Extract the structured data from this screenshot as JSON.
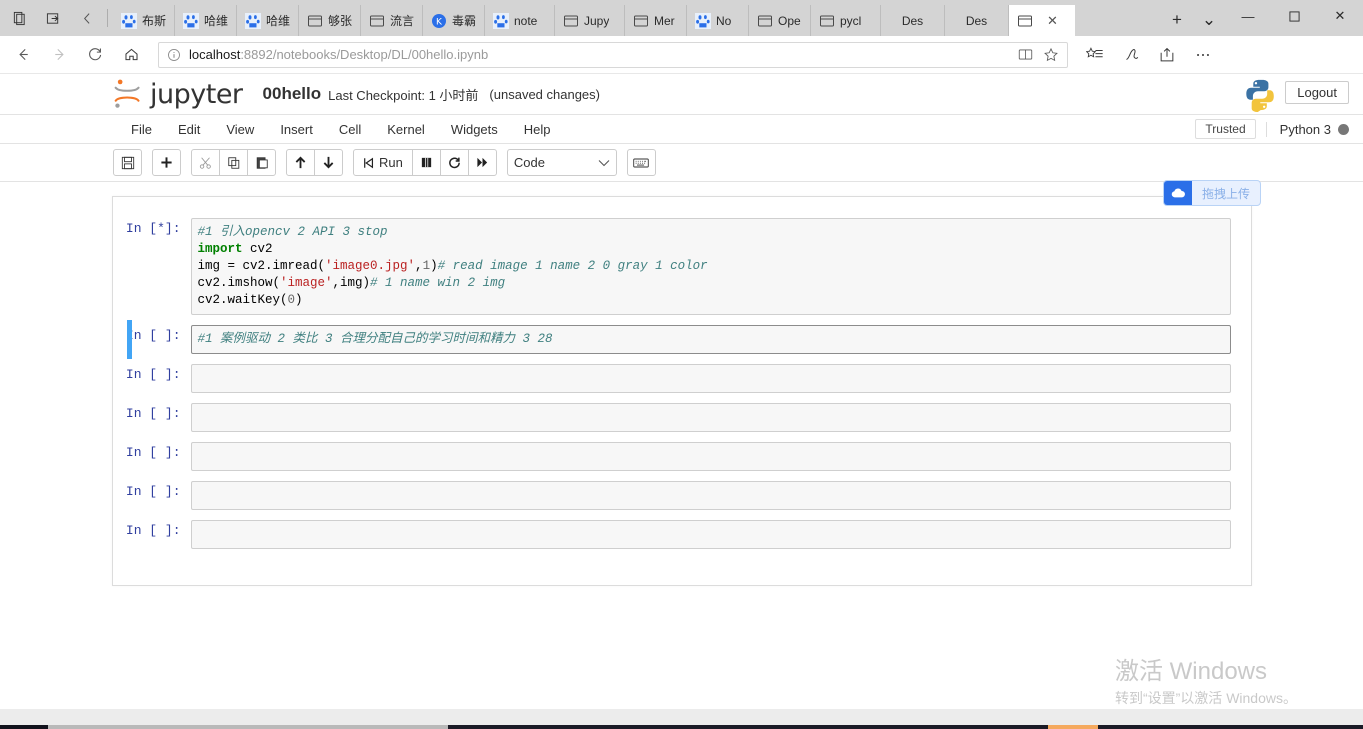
{
  "browser": {
    "window_controls": {
      "minimize": "—",
      "maximize": "☐",
      "close": "✕"
    },
    "nav": {
      "back_icon": "back-arrow-icon",
      "forward_icon": "forward-arrow-icon",
      "refresh_icon": "refresh-icon",
      "home_icon": "home-icon"
    },
    "url": {
      "host": "localhost",
      "rest": ":8892/notebooks/Desktop/DL/00hello.ipynb"
    },
    "new_tab_label": "+",
    "tab_list_label": "⌄",
    "tabs": [
      {
        "label": "布斯",
        "icon": "baidu-favicon",
        "active": false
      },
      {
        "label": "哈维",
        "icon": "baidu-favicon",
        "active": false
      },
      {
        "label": "哈维",
        "icon": "baidu-favicon",
        "active": false
      },
      {
        "label": "够张",
        "icon": "window-favicon",
        "active": false
      },
      {
        "label": "流言",
        "icon": "window-favicon",
        "active": false
      },
      {
        "label": "毒霸",
        "icon": "k-favicon",
        "active": false
      },
      {
        "label": "note",
        "icon": "baidu-favicon",
        "active": false
      },
      {
        "label": "Jupy",
        "icon": "window-favicon",
        "active": false
      },
      {
        "label": "Mer",
        "icon": "window-favicon",
        "active": false
      },
      {
        "label": "No",
        "icon": "baidu-favicon",
        "active": false
      },
      {
        "label": "Ope",
        "icon": "window-favicon",
        "active": false
      },
      {
        "label": "pycl",
        "icon": "window-favicon",
        "active": false
      },
      {
        "label": "Des",
        "icon": "none",
        "active": false
      },
      {
        "label": "Des",
        "icon": "none",
        "active": false
      },
      {
        "label": "",
        "icon": "window-favicon",
        "active": true
      }
    ]
  },
  "jupyter": {
    "logo_text": "jupyter",
    "notebook_name": "00hello",
    "checkpoint": "Last Checkpoint: 1 小时前",
    "save_state": "(unsaved changes)",
    "logout_label": "Logout",
    "trusted_label": "Trusted",
    "kernel_name": "Python 3",
    "menu": [
      "File",
      "Edit",
      "View",
      "Insert",
      "Cell",
      "Kernel",
      "Widgets",
      "Help"
    ],
    "toolbar": {
      "save_title": "save-icon",
      "insert_title": "plus-icon",
      "cut_title": "scissors-icon",
      "copy_title": "copy-icon",
      "paste_title": "paste-icon",
      "move_up_title": "arrow-up-icon",
      "move_down_title": "arrow-down-icon",
      "run_label": "Run",
      "stop_title": "stop-icon",
      "restart_title": "restart-icon",
      "restart_run_all_title": "fast-forward-icon",
      "cell_type": "Code",
      "cell_type_caret": "⌄",
      "keyboard_title": "keyboard-icon"
    },
    "cells": [
      {
        "prompt": "In [*]:",
        "selected": false,
        "empty": false,
        "lines": [
          [
            {
              "t": "comment",
              "v": "#1 引入opencv 2 API 3 stop"
            }
          ],
          [
            {
              "t": "kw",
              "v": "import"
            },
            {
              "t": "plain",
              "v": " cv2"
            }
          ],
          [
            {
              "t": "plain",
              "v": "img = cv2.imread("
            },
            {
              "t": "str",
              "v": "'image0.jpg'"
            },
            {
              "t": "plain",
              "v": ","
            },
            {
              "t": "num",
              "v": "1"
            },
            {
              "t": "plain",
              "v": ")"
            },
            {
              "t": "comment",
              "v": "# read image 1 name 2 0 gray 1 color"
            }
          ],
          [
            {
              "t": "plain",
              "v": "cv2.imshow("
            },
            {
              "t": "str",
              "v": "'image'"
            },
            {
              "t": "plain",
              "v": ",img)"
            },
            {
              "t": "comment",
              "v": "# 1 name win 2 img"
            }
          ],
          [
            {
              "t": "plain",
              "v": "cv2.waitKey("
            },
            {
              "t": "num",
              "v": "0"
            },
            {
              "t": "plain",
              "v": ")"
            }
          ]
        ]
      },
      {
        "prompt": "In [ ]:",
        "selected": true,
        "empty": false,
        "lines": [
          [
            {
              "t": "comment",
              "v": "#1 案例驱动 2 类比 3 合理分配自己的学习时间和精力 3 28"
            }
          ]
        ]
      },
      {
        "prompt": "In [ ]:",
        "selected": false,
        "empty": true,
        "lines": []
      },
      {
        "prompt": "In [ ]:",
        "selected": false,
        "empty": true,
        "lines": []
      },
      {
        "prompt": "In [ ]:",
        "selected": false,
        "empty": true,
        "lines": []
      },
      {
        "prompt": "In [ ]:",
        "selected": false,
        "empty": true,
        "lines": []
      },
      {
        "prompt": "In [ ]:",
        "selected": false,
        "empty": true,
        "lines": []
      }
    ]
  },
  "netdisk_overlay": {
    "label": "拖拽上传"
  },
  "watermark": {
    "title": "激活 Windows",
    "subtitle": "转到“设置”以激活 Windows。"
  },
  "colors": {
    "accent": "#42A5F5",
    "netdisk": "#2b6fe8",
    "prompt": "#303F9F",
    "comment": "#408080",
    "string": "#BA2121",
    "keyword": "#008000"
  }
}
